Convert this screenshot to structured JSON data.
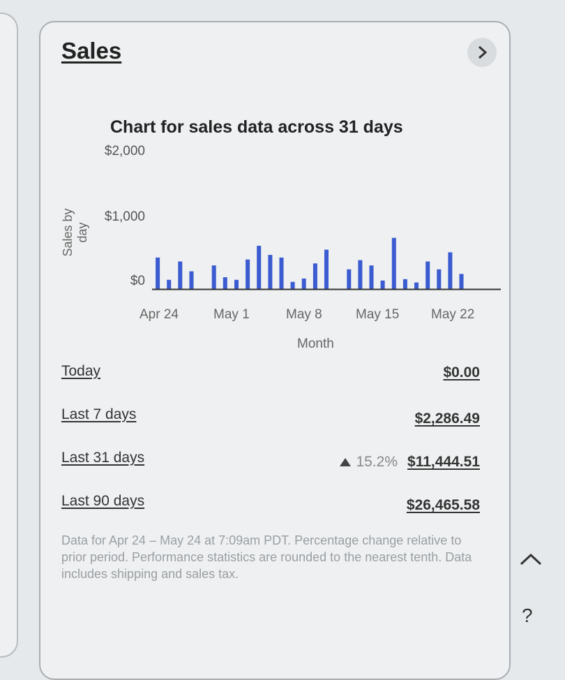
{
  "card": {
    "title": "Sales"
  },
  "chart_data": {
    "type": "bar",
    "title": "Chart for sales data across 31 days",
    "ylabel": "Sales by day",
    "xlabel": "Month",
    "ylim": [
      0,
      2000
    ],
    "y_ticks": [
      "$2,000",
      "$1,000",
      "$0"
    ],
    "x_ticks": [
      "Apr 24",
      "May 1",
      "May 8",
      "May 15",
      "May 22"
    ],
    "categories": [
      "Apr 24",
      "Apr 25",
      "Apr 26",
      "Apr 27",
      "Apr 28",
      "Apr 29",
      "Apr 30",
      "May 1",
      "May 2",
      "May 3",
      "May 4",
      "May 5",
      "May 6",
      "May 7",
      "May 8",
      "May 9",
      "May 10",
      "May 11",
      "May 12",
      "May 13",
      "May 14",
      "May 15",
      "May 16",
      "May 17",
      "May 18",
      "May 19",
      "May 20",
      "May 21",
      "May 22",
      "May 23",
      "May 24"
    ],
    "values": [
      480,
      140,
      420,
      270,
      0,
      360,
      180,
      140,
      450,
      660,
      520,
      480,
      110,
      160,
      390,
      600,
      0,
      300,
      440,
      360,
      130,
      780,
      150,
      100,
      420,
      300,
      560,
      230,
      0,
      0,
      0
    ],
    "color": "#3b5bd1"
  },
  "stats": {
    "today": {
      "label": "Today",
      "value": "$0.00"
    },
    "last7": {
      "label": "Last 7 days",
      "value": "$2,286.49"
    },
    "last31": {
      "label": "Last 31 days",
      "value": "$11,444.51",
      "change": "15.2%"
    },
    "last90": {
      "label": "Last 90 days",
      "value": "$26,465.58"
    }
  },
  "note": "Data for Apr 24 – May 24 at 7:09am PDT. Percentage change relative to prior period. Performance statistics are rounded to the nearest tenth. Data includes shipping and sales tax.",
  "help_label": "?"
}
